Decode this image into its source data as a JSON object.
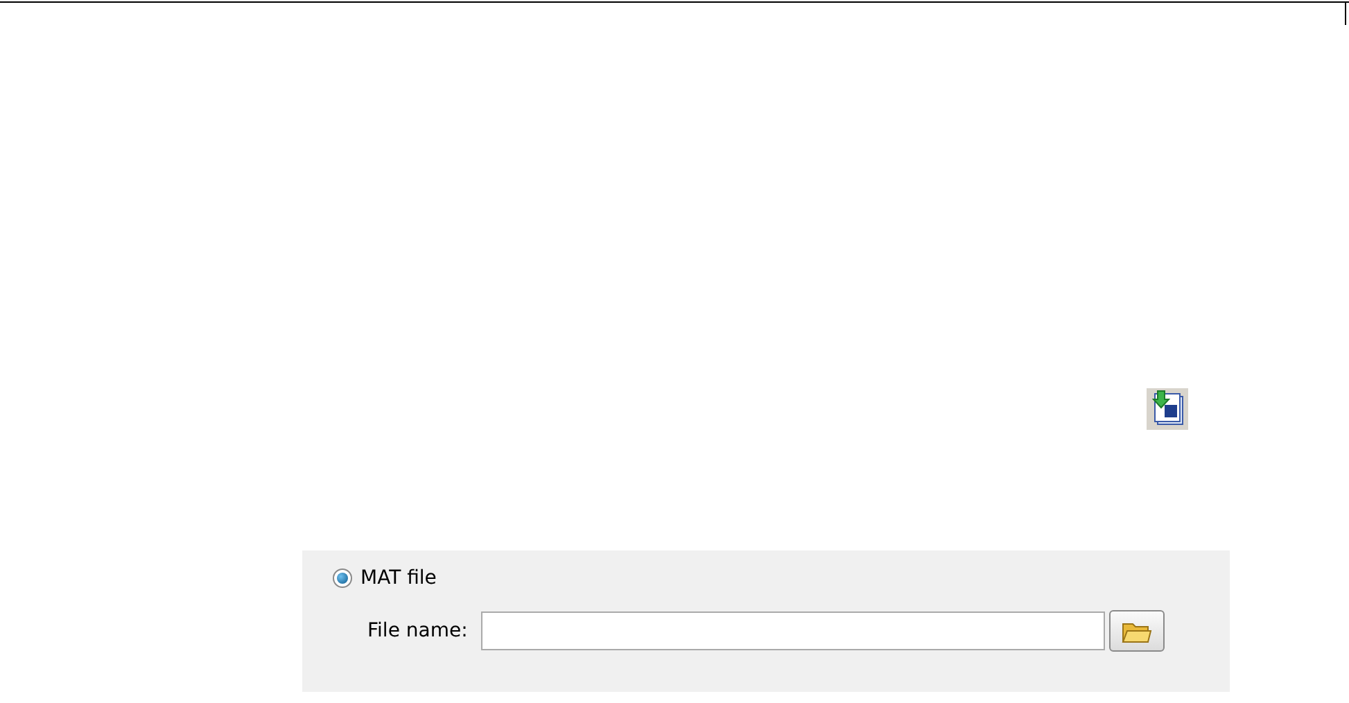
{
  "toolbar_icon": {
    "kind": "import"
  },
  "source_panel": {
    "radio": {
      "label": "MAT file",
      "selected": true
    },
    "file_field": {
      "label": "File name:"
    }
  }
}
